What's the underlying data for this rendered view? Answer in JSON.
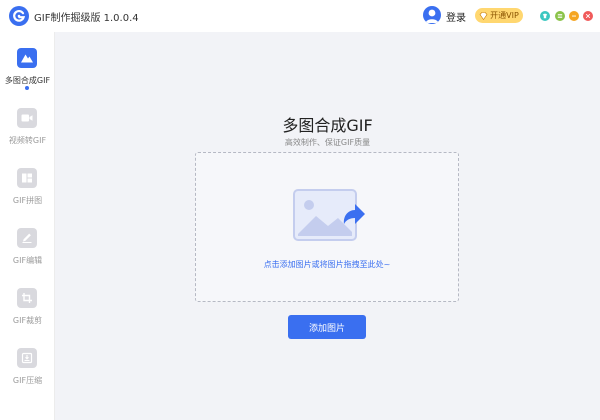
{
  "app": {
    "title": "GIF制作掘级版 1.0.0.4",
    "accent_color": "#3a6ff0"
  },
  "header": {
    "login_label": "登录",
    "vip_label": "开通VIP",
    "vip_icon": "diamond-icon",
    "window_controls": [
      {
        "name": "skin-button",
        "icon": "skin-icon",
        "color": "#3cc7c0"
      },
      {
        "name": "menu-button",
        "icon": "menu-icon",
        "color": "#8bc34a"
      },
      {
        "name": "minimize-button",
        "icon": "minimize-icon",
        "color": "#f5a623"
      },
      {
        "name": "close-button",
        "icon": "close-icon",
        "color": "#f05a5a"
      }
    ]
  },
  "sidebar": {
    "items": [
      {
        "label": "多图合成GIF",
        "icon": "image-mountain-icon",
        "active": true
      },
      {
        "label": "视频转GIF",
        "icon": "video-icon",
        "active": false
      },
      {
        "label": "GIF拼图",
        "icon": "collage-icon",
        "active": false
      },
      {
        "label": "GIF编辑",
        "icon": "edit-icon",
        "active": false
      },
      {
        "label": "GIF裁剪",
        "icon": "crop-icon",
        "active": false
      },
      {
        "label": "GIF压缩",
        "icon": "compress-icon",
        "active": false
      }
    ]
  },
  "main": {
    "title": "多图合成GIF",
    "subtitle": "高效制作、保证GIF质量",
    "drop_zone": {
      "icon": "add-image-icon",
      "text": "点击添加图片或将图片拖拽至此处~"
    },
    "add_button_label": "添加图片"
  }
}
